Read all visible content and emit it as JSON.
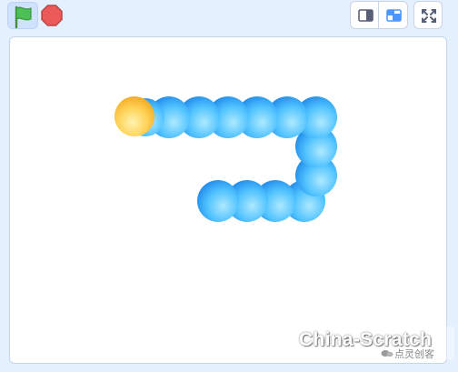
{
  "toolbar": {
    "green_flag_icon": "green-flag-icon",
    "stop_icon": "stop-sign-icon",
    "small_stage_icon": "small-stage-icon",
    "large_stage_icon": "large-stage-icon",
    "fullscreen_icon": "fullscreen-icon"
  },
  "colors": {
    "page_background": "#e5f0ff",
    "flag_green": "#4cbf56",
    "stop_red": "#ec5959",
    "accent_blue": "#4c97ff",
    "snake_body": "#29a9ff",
    "snake_head": "#ffbf2e"
  },
  "stage": {
    "snake": {
      "head_count": 1,
      "body_segment_count": 11
    }
  },
  "watermark": {
    "main_text": "China-Scratch",
    "sub_text": "点灵创客"
  }
}
